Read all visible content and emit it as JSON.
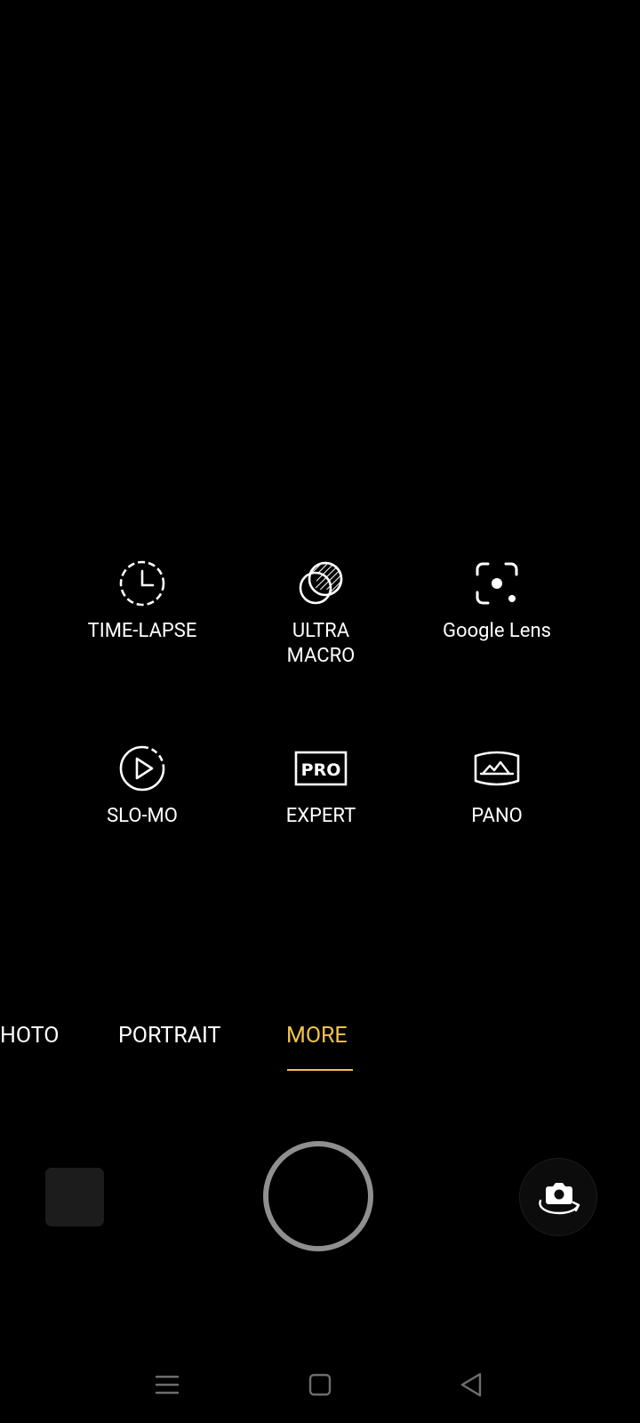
{
  "modes": [
    {
      "id": "time-lapse",
      "label": "TIME-LAPSE",
      "icon": "timer-dashed-icon"
    },
    {
      "id": "ultra-macro",
      "label": "ULTRA\nMACRO",
      "icon": "macro-lens-icon"
    },
    {
      "id": "google-lens",
      "label": "Google Lens",
      "icon": "google-lens-icon"
    },
    {
      "id": "slo-mo",
      "label": "SLO-MO",
      "icon": "slow-motion-play-icon"
    },
    {
      "id": "expert",
      "label": "EXPERT",
      "icon": "pro-badge-icon",
      "icon_text": "PRO"
    },
    {
      "id": "pano",
      "label": "PANO",
      "icon": "panorama-mountain-icon"
    }
  ],
  "mode_strip": {
    "tabs": [
      {
        "label": "HOTO",
        "active": false
      },
      {
        "label": "PORTRAIT",
        "active": false
      },
      {
        "label": "MORE",
        "active": true
      }
    ]
  },
  "controls": {
    "gallery": "gallery-thumbnail",
    "shutter": "shutter-button",
    "flip": "switch-camera-icon"
  },
  "colors": {
    "background": "#000000",
    "accent": "#f2c34b",
    "text": "#ffffff",
    "shutter_ring": "#8f8f8f",
    "nav_icons": "#6e6e6e"
  },
  "navigation": [
    "menu-icon",
    "home-square-icon",
    "back-triangle-icon"
  ]
}
